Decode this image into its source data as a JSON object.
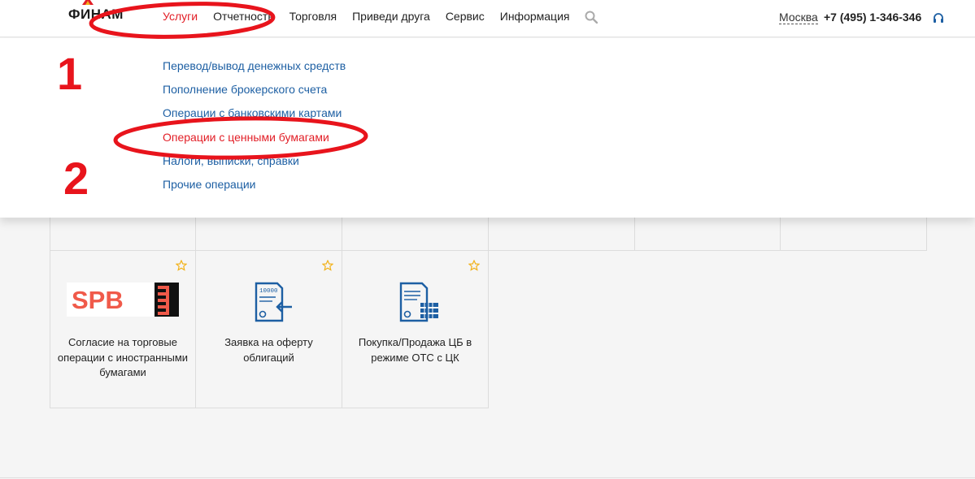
{
  "header": {
    "logo_text": "ФИНАМ",
    "nav": [
      "Услуги",
      "Отчетность",
      "Торговля",
      "Приведи друга",
      "Сервис",
      "Информация"
    ],
    "city": "Москва",
    "phone": "+7 (495) 1-346-346"
  },
  "dropdown": {
    "items": [
      "Перевод/вывод денежных средств",
      "Пополнение брокерского счета",
      "Операции с банковскими картами",
      "Операции с ценными бумагами",
      "Налоги, выписки, справки",
      "Прочие операции"
    ]
  },
  "annotations": {
    "marker_1": "1",
    "marker_2": "2"
  },
  "cards": [
    {
      "label": "Согласие на торговые операции с иностранными бумагами",
      "icon": "spb-exchange-logo",
      "logo_text": "SPB"
    },
    {
      "label": "Заявка на оферту облигаций",
      "icon": "bond-offer-document-icon",
      "icon_text": "10000"
    },
    {
      "label": "Покупка/Продажа ЦБ в режиме ОТС с ЦК",
      "icon": "otc-trade-document-icon"
    }
  ],
  "colors": {
    "accent_red": "#e21e26",
    "link_blue": "#1d5fa3",
    "icon_blue": "#1d5fa3",
    "star": "#f2b21a",
    "spb_red": "#f05a4a"
  }
}
